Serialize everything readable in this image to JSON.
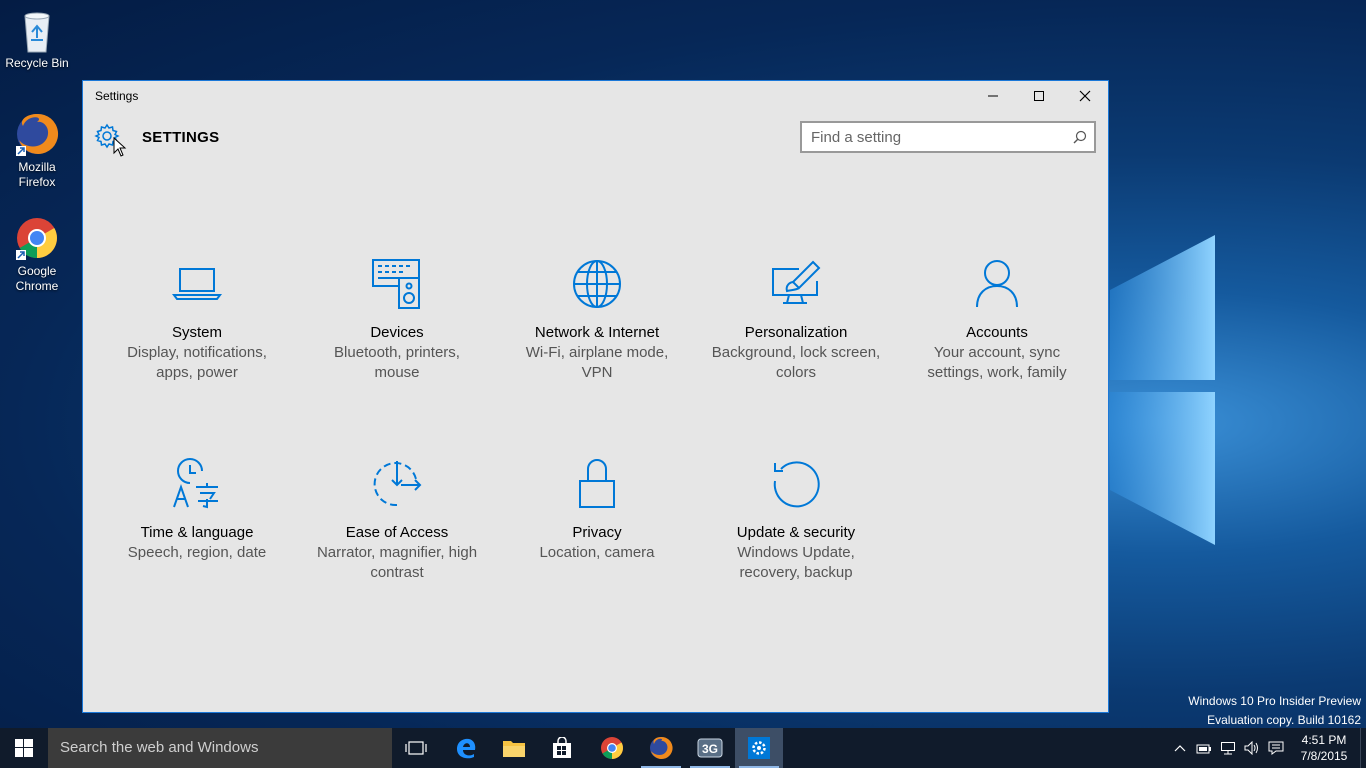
{
  "desktop": {
    "icons": [
      {
        "label": "Recycle Bin"
      },
      {
        "label": "Mozilla Firefox"
      },
      {
        "label": "Google Chrome"
      }
    ],
    "watermark_line1": "Windows 10 Pro Insider Preview",
    "watermark_line2": "Evaluation copy. Build 10162"
  },
  "window": {
    "title": "Settings",
    "heading": "SETTINGS",
    "search_placeholder": "Find a setting",
    "accent_color": "#0078d7",
    "categories": [
      {
        "name": "System",
        "description": "Display, notifications, apps, power",
        "icon": "laptop-icon"
      },
      {
        "name": "Devices",
        "description": "Bluetooth, printers, mouse",
        "icon": "devices-icon"
      },
      {
        "name": "Network & Internet",
        "description": "Wi-Fi, airplane mode, VPN",
        "icon": "globe-icon"
      },
      {
        "name": "Personalization",
        "description": "Background, lock screen, colors",
        "icon": "paintbrush-icon"
      },
      {
        "name": "Accounts",
        "description": "Your account, sync settings, work, family",
        "icon": "person-icon"
      },
      {
        "name": "Time & language",
        "description": "Speech, region, date",
        "icon": "time-language-icon"
      },
      {
        "name": "Ease of Access",
        "description": "Narrator, magnifier, high contrast",
        "icon": "ease-of-access-icon"
      },
      {
        "name": "Privacy",
        "description": "Location, camera",
        "icon": "lock-icon"
      },
      {
        "name": "Update & security",
        "description": "Windows Update, recovery, backup",
        "icon": "update-icon"
      }
    ]
  },
  "taskbar": {
    "search_placeholder": "Search the web and Windows",
    "time": "4:51 PM",
    "date": "7/8/2015",
    "pinned": [
      "task-view",
      "edge",
      "file-explorer",
      "store",
      "chrome",
      "firefox",
      "3g-app",
      "settings"
    ]
  }
}
